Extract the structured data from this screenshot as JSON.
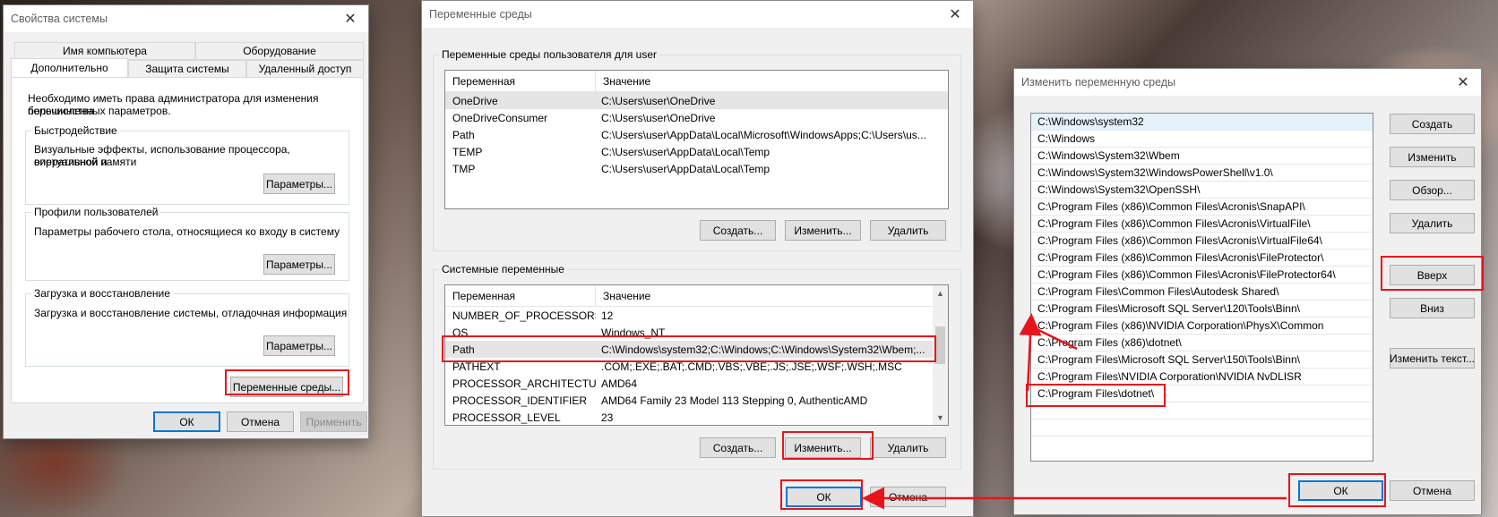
{
  "sysprops": {
    "title": "Свойства системы",
    "tabs_row1": [
      "Имя компьютера",
      "Оборудование"
    ],
    "tabs_row2": [
      "Дополнительно",
      "Защита системы",
      "Удаленный доступ"
    ],
    "admin_note_1": "Необходимо иметь права администратора для изменения большинства",
    "admin_note_2": "перечисленных параметров.",
    "perf": {
      "title": "Быстродействие",
      "desc_1": "Визуальные эффекты, использование процессора, оперативной и",
      "desc_2": "виртуальной памяти",
      "button": "Параметры..."
    },
    "profiles": {
      "title": "Профили пользователей",
      "desc_1": "Параметры рабочего стола, относящиеся ко входу в систему",
      "button": "Параметры..."
    },
    "startup": {
      "title": "Загрузка и восстановление",
      "desc_1": "Загрузка и восстановление системы, отладочная информация",
      "button": "Параметры..."
    },
    "env_button": "Переменные среды...",
    "ok": "ОК",
    "cancel": "Отмена",
    "apply": "Применить"
  },
  "envvars": {
    "title": "Переменные среды",
    "user_group_title": "Переменные среды пользователя для user",
    "columns": [
      "Переменная",
      "Значение"
    ],
    "user_vars": [
      {
        "name": "OneDrive",
        "value": "C:\\Users\\user\\OneDrive"
      },
      {
        "name": "OneDriveConsumer",
        "value": "C:\\Users\\user\\OneDrive"
      },
      {
        "name": "Path",
        "value": "C:\\Users\\user\\AppData\\Local\\Microsoft\\WindowsApps;C:\\Users\\us..."
      },
      {
        "name": "TEMP",
        "value": "C:\\Users\\user\\AppData\\Local\\Temp"
      },
      {
        "name": "TMP",
        "value": "C:\\Users\\user\\AppData\\Local\\Temp"
      }
    ],
    "user_buttons": {
      "new": "Создать...",
      "edit": "Изменить...",
      "delete": "Удалить"
    },
    "sys_group_title": "Системные переменные",
    "sys_vars": [
      {
        "name": "NUMBER_OF_PROCESSORS",
        "value": "12"
      },
      {
        "name": "OS",
        "value": "Windows_NT"
      },
      {
        "name": "Path",
        "value": "C:\\Windows\\system32;C:\\Windows;C:\\Windows\\System32\\Wbem;..."
      },
      {
        "name": "PATHEXT",
        "value": ".COM;.EXE;.BAT;.CMD;.VBS;.VBE;.JS;.JSE;.WSF;.WSH;.MSC"
      },
      {
        "name": "PROCESSOR_ARCHITECTURE",
        "value": "AMD64"
      },
      {
        "name": "PROCESSOR_IDENTIFIER",
        "value": "AMD64 Family 23 Model 113 Stepping 0, AuthenticAMD"
      },
      {
        "name": "PROCESSOR_LEVEL",
        "value": "23"
      }
    ],
    "sys_buttons": {
      "new": "Создать...",
      "edit": "Изменить...",
      "delete": "Удалить"
    },
    "ok": "ОК",
    "cancel": "Отмена"
  },
  "editvar": {
    "title": "Изменить переменную среды",
    "paths": [
      "C:\\Windows\\system32",
      "C:\\Windows",
      "C:\\Windows\\System32\\Wbem",
      "C:\\Windows\\System32\\WindowsPowerShell\\v1.0\\",
      "C:\\Windows\\System32\\OpenSSH\\",
      "C:\\Program Files (x86)\\Common Files\\Acronis\\SnapAPI\\",
      "C:\\Program Files (x86)\\Common Files\\Acronis\\VirtualFile\\",
      "C:\\Program Files (x86)\\Common Files\\Acronis\\VirtualFile64\\",
      "C:\\Program Files (x86)\\Common Files\\Acronis\\FileProtector\\",
      "C:\\Program Files (x86)\\Common Files\\Acronis\\FileProtector64\\",
      "C:\\Program Files\\Common Files\\Autodesk Shared\\",
      "C:\\Program Files\\Microsoft SQL Server\\120\\Tools\\Binn\\",
      "C:\\Program Files (x86)\\NVIDIA Corporation\\PhysX\\Common",
      "C:\\Program Files (x86)\\dotnet\\",
      "C:\\Program Files\\Microsoft SQL Server\\150\\Tools\\Binn\\",
      "C:\\Program Files\\NVIDIA Corporation\\NVIDIA NvDLISR",
      "C:\\Program Files\\dotnet\\"
    ],
    "buttons": {
      "new": "Создать",
      "edit": "Изменить",
      "browse": "Обзор...",
      "delete": "Удалить",
      "up": "Вверх",
      "down": "Вниз",
      "edit_text": "Изменить текст..."
    },
    "ok": "ОК",
    "cancel": "Отмена"
  },
  "colors": {
    "annotation_red": "#e8141c",
    "selection_blue": "#0078d7"
  }
}
